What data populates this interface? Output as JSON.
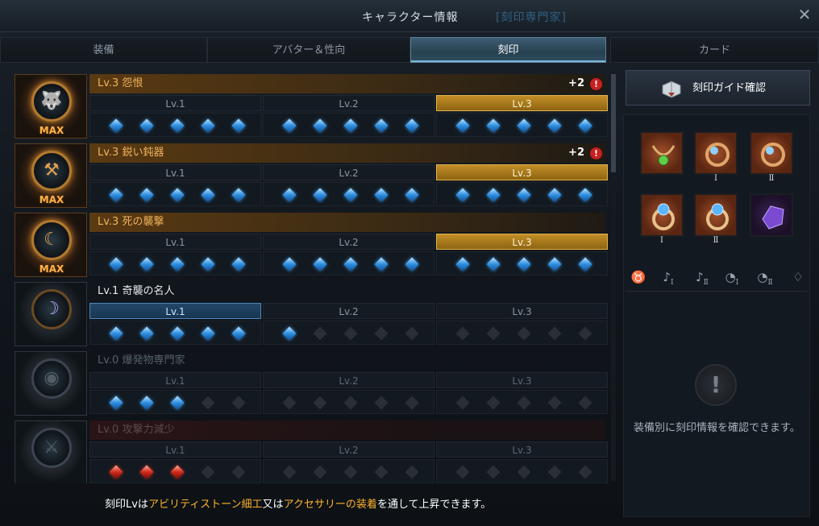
{
  "window": {
    "title": "キャラクター情報",
    "subtitle": "[刻印専門家]",
    "close_label": "✕"
  },
  "tabs": [
    {
      "label": "装備",
      "active": false
    },
    {
      "label": "アバター＆性向",
      "active": false
    },
    {
      "label": "刻印",
      "active": true
    },
    {
      "label": "カード",
      "active": false
    }
  ],
  "level_labels": [
    "Lv.1",
    "Lv.2",
    "Lv.3"
  ],
  "engravings": [
    {
      "name": "Lv.3 怨恨",
      "level": 3,
      "badge": "MAX",
      "bonus": "+2",
      "warning": "!",
      "gems": [
        5,
        5,
        5
      ],
      "gem_color": "blue",
      "icon": "wolf-icon"
    },
    {
      "name": "Lv.3 鋭い鈍器",
      "level": 3,
      "badge": "MAX",
      "bonus": "+2",
      "warning": "!",
      "gems": [
        5,
        5,
        5
      ],
      "gem_color": "blue",
      "icon": "hammer-icon"
    },
    {
      "name": "Lv.3 死の襲撃",
      "level": 3,
      "badge": "MAX",
      "bonus": "",
      "warning": "",
      "gems": [
        5,
        5,
        5
      ],
      "gem_color": "blue",
      "icon": "scythe-icon"
    },
    {
      "name": "Lv.1 奇襲の名人",
      "level": 1,
      "badge": "",
      "bonus": "",
      "warning": "",
      "gems": [
        5,
        1,
        0
      ],
      "gem_color": "blue",
      "icon": "moon-slash-icon"
    },
    {
      "name": "Lv.0 爆発物専門家",
      "level": 0,
      "badge": "",
      "bonus": "",
      "warning": "",
      "gems": [
        3,
        0,
        0
      ],
      "gem_color": "blue",
      "icon": "eye-icon"
    },
    {
      "name": "Lv.0 攻撃力減少",
      "level": 0,
      "badge": "",
      "bonus": "",
      "warning": "",
      "gems": [
        3,
        0,
        0
      ],
      "gem_color": "red",
      "icon": "broken-sword-icon"
    }
  ],
  "footer": {
    "part1": "刻印Lvは",
    "highlight1": "アビリティストーン細工",
    "part2": "又は",
    "highlight2": "アクセサリーの装着",
    "part3": "を通して上昇できます。"
  },
  "right_panel": {
    "guide_button": "刻印ガイド確認",
    "slots": [
      {
        "name": "necklace",
        "roman": "",
        "icon": "necklace-icon"
      },
      {
        "name": "earring-1",
        "roman": "Ⅰ",
        "icon": "earring-icon"
      },
      {
        "name": "earring-2",
        "roman": "Ⅱ",
        "icon": "earring-icon"
      },
      {
        "name": "ring-1",
        "roman": "Ⅰ",
        "icon": "ring-icon"
      },
      {
        "name": "ring-2",
        "roman": "Ⅱ",
        "icon": "ring-icon"
      },
      {
        "name": "ability-stone",
        "roman": "",
        "icon": "ability-stone-icon"
      }
    ],
    "filters": [
      {
        "name": "necklace",
        "glyph": "♉",
        "sub": ""
      },
      {
        "name": "earring-1",
        "glyph": "♪",
        "sub": "Ⅰ"
      },
      {
        "name": "earring-2",
        "glyph": "♪",
        "sub": "Ⅱ"
      },
      {
        "name": "ring-1",
        "glyph": "◔",
        "sub": "Ⅰ"
      },
      {
        "name": "ring-2",
        "glyph": "◔",
        "sub": "Ⅱ"
      },
      {
        "name": "ability-stone",
        "glyph": "♢",
        "sub": ""
      }
    ],
    "info_icon": "!",
    "info_text": "装備別に刻印情報を確認できます。"
  },
  "colors": {
    "gold": "#f0b25c",
    "blue_gem": "#2f8fe0",
    "red_gem": "#d02a1a",
    "warning": "#c81f1f",
    "highlight": "#ffb32b"
  }
}
